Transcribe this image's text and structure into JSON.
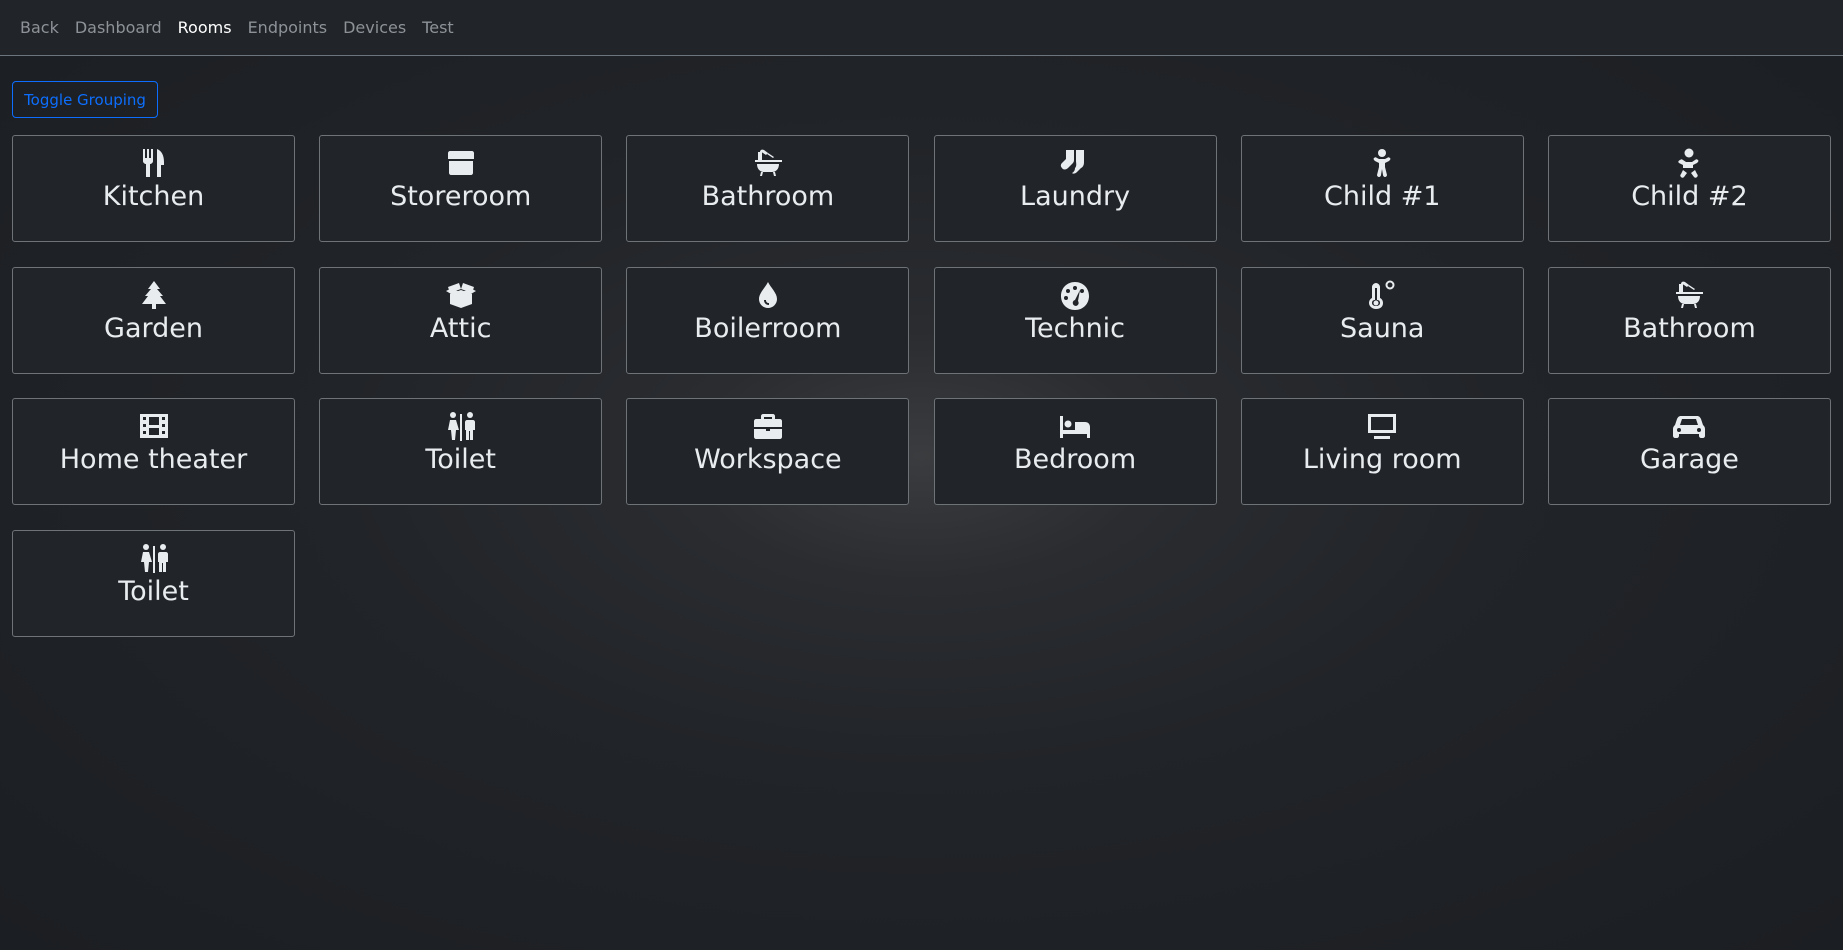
{
  "nav": {
    "items": [
      {
        "label": "Back",
        "active": false
      },
      {
        "label": "Dashboard",
        "active": false
      },
      {
        "label": "Rooms",
        "active": true
      },
      {
        "label": "Endpoints",
        "active": false
      },
      {
        "label": "Devices",
        "active": false
      },
      {
        "label": "Test",
        "active": false
      }
    ]
  },
  "toolbar": {
    "toggle_label": "Toggle Grouping"
  },
  "colors": {
    "accent": "#0d6efd",
    "tile_bg": "#212529",
    "tile_border": "#6e7378",
    "text": "#e9ecef"
  },
  "rooms": [
    {
      "label": "Kitchen",
      "icon": "utensils-icon"
    },
    {
      "label": "Storeroom",
      "icon": "archive-box-icon"
    },
    {
      "label": "Bathroom",
      "icon": "bath-icon"
    },
    {
      "label": "Laundry",
      "icon": "socks-icon"
    },
    {
      "label": "Child #1",
      "icon": "child-icon"
    },
    {
      "label": "Child #2",
      "icon": "baby-icon"
    },
    {
      "label": "Garden",
      "icon": "tree-icon"
    },
    {
      "label": "Attic",
      "icon": "box-open-icon"
    },
    {
      "label": "Boilerroom",
      "icon": "droplet-icon"
    },
    {
      "label": "Technic",
      "icon": "gauge-icon"
    },
    {
      "label": "Sauna",
      "icon": "thermometer-icon"
    },
    {
      "label": "Bathroom",
      "icon": "bath-icon"
    },
    {
      "label": "Home theater",
      "icon": "film-icon"
    },
    {
      "label": "Toilet",
      "icon": "restroom-icon"
    },
    {
      "label": "Workspace",
      "icon": "briefcase-icon"
    },
    {
      "label": "Bedroom",
      "icon": "bed-icon"
    },
    {
      "label": "Living room",
      "icon": "tv-icon"
    },
    {
      "label": "Garage",
      "icon": "car-icon"
    },
    {
      "label": "Toilet",
      "icon": "restroom-icon"
    }
  ]
}
